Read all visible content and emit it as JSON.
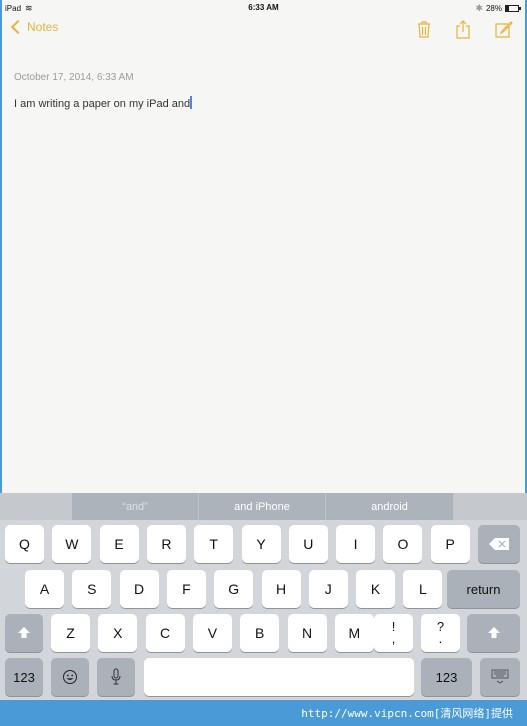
{
  "status_bar": {
    "device": "iPad",
    "wifi_icon": "wifi-icon",
    "time": "6:33 AM",
    "bluetooth_icon": "bluetooth-icon",
    "battery_percent": "28%",
    "battery_level": 0.28
  },
  "nav": {
    "back_label": "Notes",
    "icons": [
      "trash-icon",
      "share-icon",
      "compose-icon"
    ]
  },
  "accent_color": "#e8b43a",
  "note": {
    "date": "October 17, 2014, 6:33 AM",
    "text": "I am writing a paper on my iPad and"
  },
  "keyboard": {
    "suggestions": [
      "“and”",
      "and iPhone",
      "android"
    ],
    "row1": [
      "Q",
      "W",
      "E",
      "R",
      "T",
      "Y",
      "U",
      "I",
      "O",
      "P"
    ],
    "row2": [
      "A",
      "S",
      "D",
      "F",
      "G",
      "H",
      "J",
      "K",
      "L"
    ],
    "row3": [
      "Z",
      "X",
      "C",
      "V",
      "B",
      "N",
      "M"
    ],
    "punct1": {
      "top": "!",
      "bottom": ","
    },
    "punct2": {
      "top": "?",
      "bottom": "."
    },
    "return_label": "return",
    "numbers_label": "123",
    "delete_icon": "backspace-icon",
    "shift_icon": "shift-icon",
    "emoji_icon": "emoji-icon",
    "mic_icon": "microphone-icon",
    "dismiss_icon": "keyboard-dismiss-icon"
  },
  "footer": {
    "text": "http://www.vipcn.com[清风网络]提供"
  }
}
